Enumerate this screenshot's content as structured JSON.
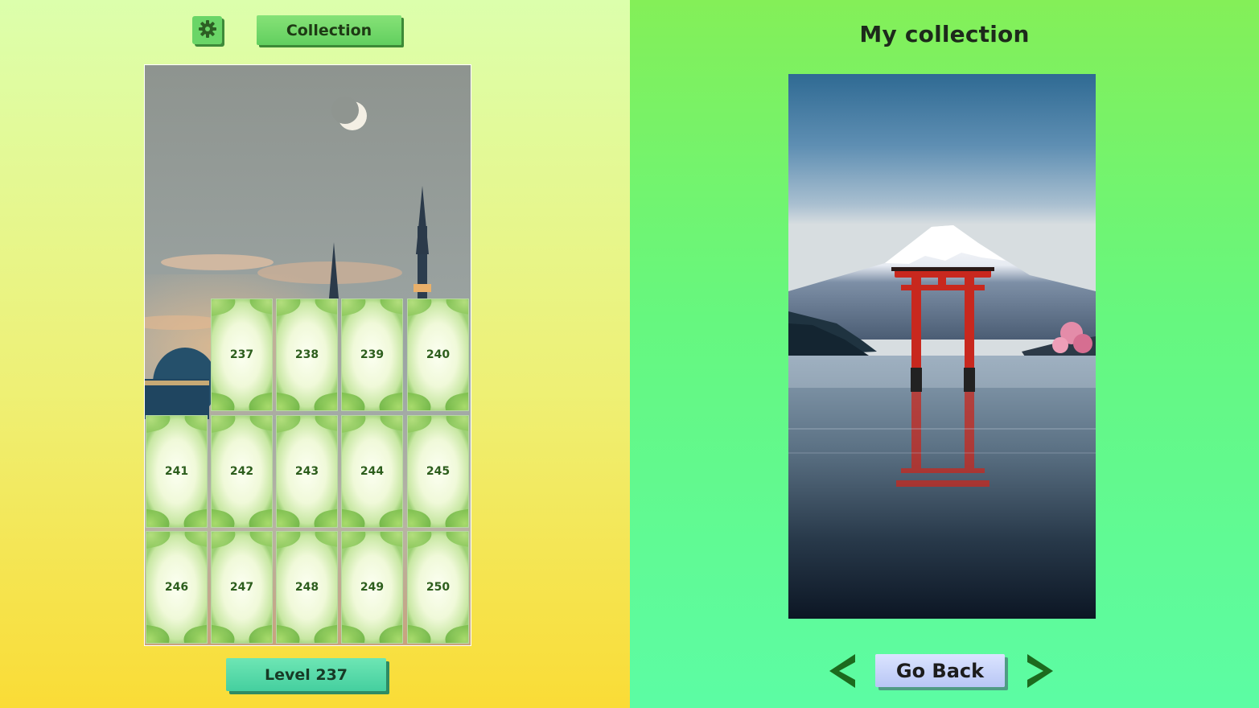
{
  "left": {
    "collection_label": "Collection",
    "level_label": "Level 237",
    "tiles": [
      "237",
      "238",
      "239",
      "240",
      "241",
      "242",
      "243",
      "244",
      "245",
      "246",
      "247",
      "248",
      "249",
      "250"
    ]
  },
  "right": {
    "title": "My collection",
    "go_back_label": "Go Back"
  },
  "icons": {
    "settings": "gear-icon",
    "prev": "arrow-left-icon",
    "next": "arrow-right-icon"
  },
  "colors": {
    "button_green": "#62cf5f",
    "level_teal": "#45cf9f",
    "go_back_lavender": "#b8c6f5",
    "arrow_green": "#1c6a1e",
    "tile_number": "#2d5e1d"
  }
}
